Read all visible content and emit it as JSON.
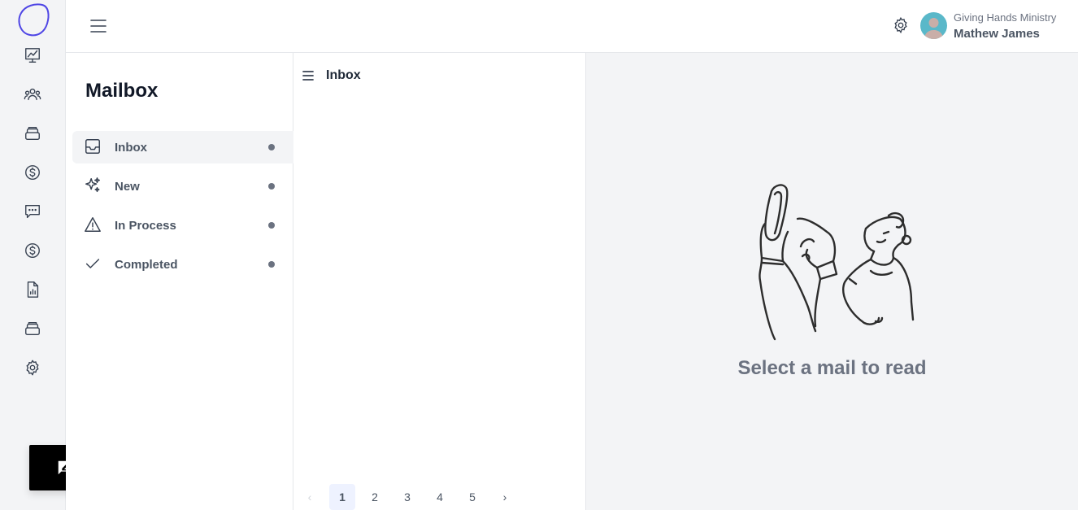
{
  "header": {
    "org_name": "Giving Hands Ministry",
    "user_name": "Mathew James"
  },
  "rail": {
    "items": [
      {
        "icon": "chart-icon"
      },
      {
        "icon": "users-icon"
      },
      {
        "icon": "stack-icon"
      },
      {
        "icon": "dollar-icon"
      },
      {
        "icon": "chat-icon"
      },
      {
        "icon": "dollar-icon"
      },
      {
        "icon": "report-icon"
      },
      {
        "icon": "stack-icon"
      },
      {
        "icon": "gear-icon"
      }
    ]
  },
  "mailbox": {
    "title": "Mailbox",
    "folders": [
      {
        "label": "Inbox",
        "icon": "inbox-icon",
        "active": true
      },
      {
        "label": "New",
        "icon": "sparkles-icon",
        "active": false
      },
      {
        "label": "In Process",
        "icon": "warning-icon",
        "active": false
      },
      {
        "label": "Completed",
        "icon": "check-icon",
        "active": false
      }
    ]
  },
  "list": {
    "title": "Inbox",
    "pagination": {
      "prev": "‹",
      "pages": [
        "1",
        "2",
        "3",
        "4",
        "5"
      ],
      "current": "1",
      "next": "›"
    }
  },
  "reader": {
    "empty_message": "Select a mail to read"
  },
  "colors": {
    "brand_logo": "#4f46e5",
    "avatar_bg": "#5ab8c9",
    "active_page_bg": "#eef2ff"
  }
}
